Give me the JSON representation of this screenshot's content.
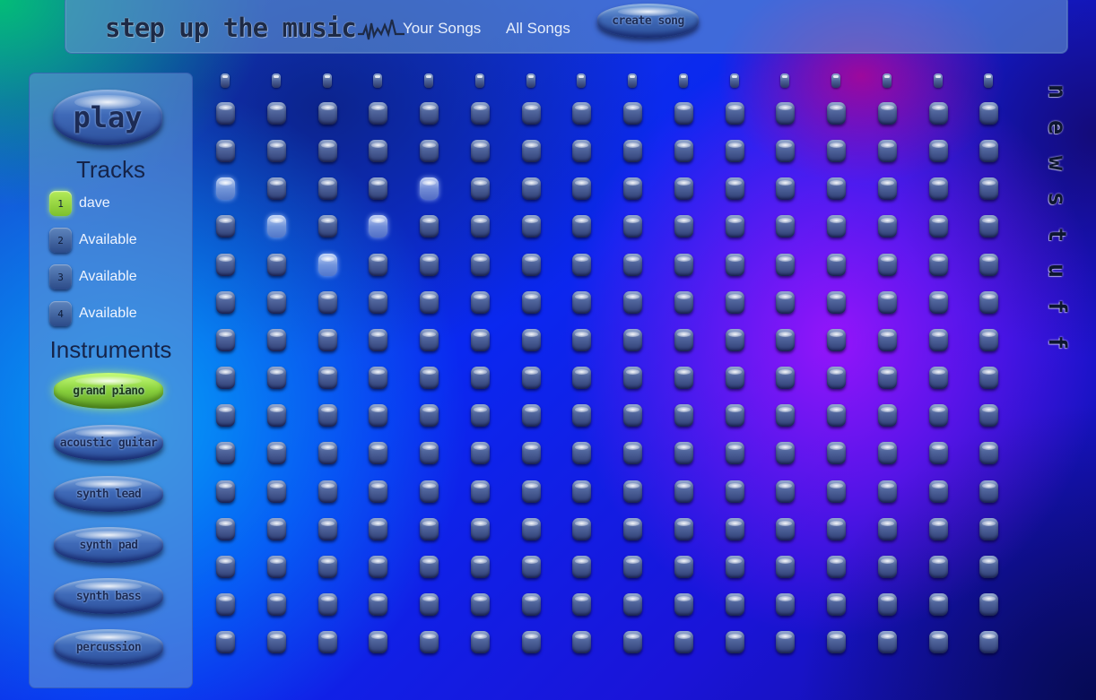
{
  "header": {
    "logo_text": "step up the music",
    "nav": [
      {
        "label": "Your Songs"
      },
      {
        "label": "All Songs"
      }
    ],
    "create_song_label": "create song"
  },
  "sidebar": {
    "play_label": "play",
    "tracks_title": "Tracks",
    "tracks": [
      {
        "number": "1",
        "label": "dave",
        "active": true
      },
      {
        "number": "2",
        "label": "Available",
        "active": false
      },
      {
        "number": "3",
        "label": "Available",
        "active": false
      },
      {
        "number": "4",
        "label": "Available",
        "active": false
      }
    ],
    "instruments_title": "Instruments",
    "instruments": [
      {
        "label": "grand piano",
        "selected": true
      },
      {
        "label": "acoustic guitar",
        "selected": false
      },
      {
        "label": "synth lead",
        "selected": false
      },
      {
        "label": "synth pad",
        "selected": false
      },
      {
        "label": "synth bass",
        "selected": false
      },
      {
        "label": "percussion",
        "selected": false
      }
    ]
  },
  "grid": {
    "steps": 16,
    "rows": 15,
    "active_cells": [
      {
        "row": 2,
        "col": 0
      },
      {
        "row": 2,
        "col": 4
      },
      {
        "row": 3,
        "col": 1
      },
      {
        "row": 3,
        "col": 3
      },
      {
        "row": 4,
        "col": 2
      }
    ]
  },
  "side_text": "newstuff",
  "colors": {
    "selected_green": "#9be24f",
    "panel_blue": "#6092d6"
  }
}
